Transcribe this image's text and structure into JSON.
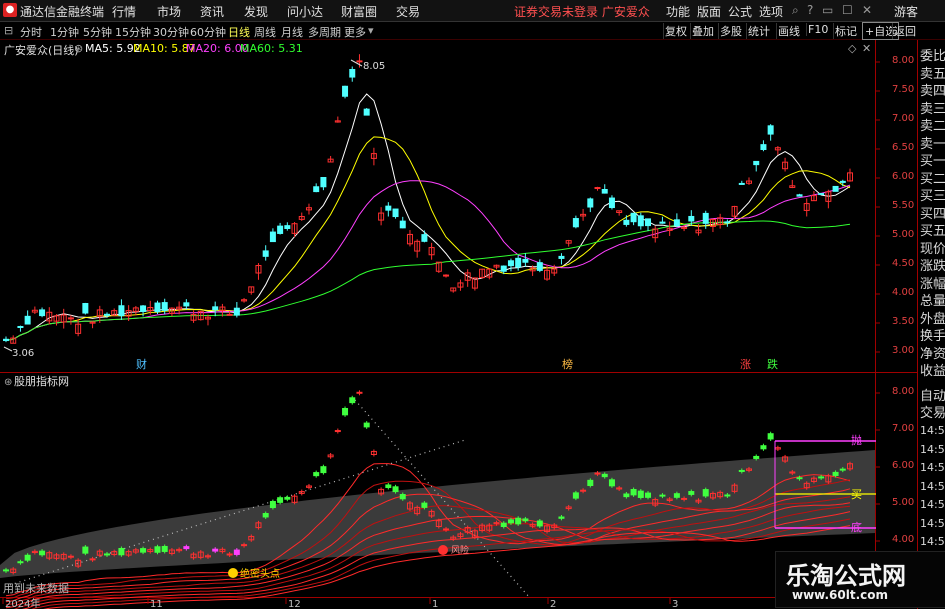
{
  "menubar": {
    "app_title": "通达信金融终端",
    "items": [
      "行情",
      "市场",
      "资讯",
      "发现",
      "问小达",
      "财富圈",
      "交易"
    ],
    "notice": "证券交易未登录  广安爱众",
    "right_items": [
      "功能",
      "版面",
      "公式",
      "选项"
    ],
    "guest": "游客"
  },
  "tabbar": {
    "periods": [
      "分时",
      "1分钟",
      "5分钟",
      "15分钟",
      "30分钟",
      "60分钟",
      "日线",
      "周线",
      "月线",
      "多周期",
      "更多"
    ],
    "active_period": "日线",
    "tools": [
      "复权",
      "叠加",
      "多股",
      "统计",
      "画线",
      "F10",
      "标记",
      "+自选",
      "返回"
    ]
  },
  "info": {
    "stock": "广安爱众(日线)",
    "ma5": "MA5: 5.92",
    "ma10": "MA10: 5.87",
    "ma20": "MA20: 6.00",
    "ma60": "MA60: 5.31"
  },
  "colors": {
    "ma5": "#ffffff",
    "ma10": "#ffff00",
    "ma20": "#ff40ff",
    "ma60": "#30ff30",
    "up": "#ff3030",
    "down": "#50ffff",
    "axis": "#c00000"
  },
  "main_chart": {
    "y_ticks": [
      "8.00",
      "7.50",
      "7.00",
      "6.50",
      "6.00",
      "5.50",
      "5.00",
      "4.50",
      "4.00",
      "3.50",
      "3.00"
    ],
    "high_label": "8.05",
    "low_label": "3.06",
    "markers": [
      "财",
      "榜",
      "涨",
      "跌"
    ]
  },
  "indicator": {
    "title": "股朋指标网",
    "y_ticks": [
      "8.00",
      "7.00",
      "6.00",
      "5.00",
      "4.00"
    ],
    "labels": [
      "抛",
      "买",
      "底"
    ],
    "bottom_tag": "绝密头点",
    "signal_tag": "风险",
    "footer": "用到未来数据"
  },
  "sidebar": {
    "items": [
      "委比",
      "卖五",
      "卖四",
      "卖三",
      "卖二",
      "卖一",
      "买一",
      "买二",
      "买三",
      "买四",
      "买五",
      "现价",
      "涨跌",
      "涨幅",
      "总量",
      "外盘",
      "换手",
      "净资",
      "收益"
    ],
    "auto_trade": [
      "自动",
      "交易"
    ],
    "times": [
      "14:56",
      "14:56",
      "14:56",
      "14:56",
      "14:56",
      "14:56",
      "14:56",
      "14:56"
    ]
  },
  "x_axis": [
    "2024年",
    "11",
    "12",
    "1",
    "2",
    "3"
  ],
  "watermark": {
    "title": "乐淘公式网",
    "url": "www.60lt.com"
  }
}
